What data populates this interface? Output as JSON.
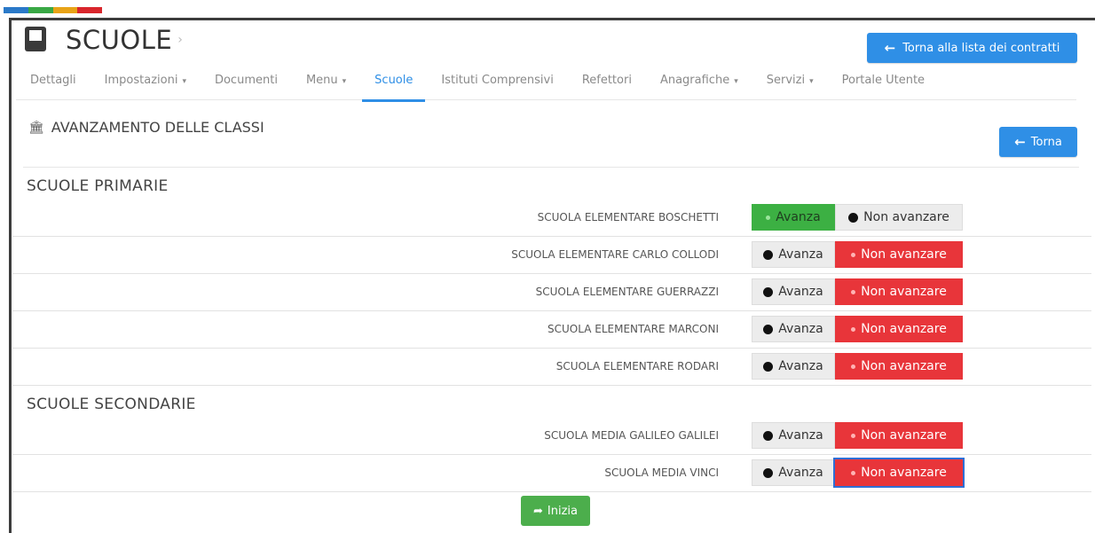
{
  "colorbar": [
    "#2a79c8",
    "#39a845",
    "#e8a317",
    "#d9262c"
  ],
  "header": {
    "title": "SCUOLE",
    "icon": "book-icon"
  },
  "back_to_contracts": {
    "label": "Torna alla lista dei contratti",
    "icon": "arrow-left-icon"
  },
  "tabs": [
    {
      "label": "Dettagli",
      "caret": ""
    },
    {
      "label": "Impostazioni",
      "caret": "▾"
    },
    {
      "label": "Documenti",
      "caret": ""
    },
    {
      "label": "Menu",
      "caret": "▾"
    },
    {
      "label": "Scuole",
      "caret": "",
      "active": true
    },
    {
      "label": "Istituti Comprensivi",
      "caret": ""
    },
    {
      "label": "Refettori",
      "caret": ""
    },
    {
      "label": "Anagrafiche",
      "caret": "▾"
    },
    {
      "label": "Servizi",
      "caret": "▾"
    },
    {
      "label": "Portale Utente",
      "caret": ""
    }
  ],
  "section": {
    "title": "AVANZAMENTO DELLE CLASSI",
    "icon": "bank-icon",
    "back_label": "Torna"
  },
  "groups": {
    "primarie": {
      "title": "SCUOLE PRIMARIE",
      "schools": [
        {
          "name": "SCUOLA ELEMENTARE BOSCHETTI",
          "state": "avanza"
        },
        {
          "name": "SCUOLA ELEMENTARE CARLO COLLODI",
          "state": "non"
        },
        {
          "name": "SCUOLA ELEMENTARE GUERRAZZI",
          "state": "non"
        },
        {
          "name": "SCUOLA ELEMENTARE MARCONI",
          "state": "non"
        },
        {
          "name": "SCUOLA ELEMENTARE RODARI",
          "state": "non"
        }
      ]
    },
    "secondarie": {
      "title": "SCUOLE SECONDARIE",
      "schools": [
        {
          "name": "SCUOLA MEDIA GALILEO GALILEI",
          "state": "non"
        },
        {
          "name": "SCUOLA MEDIA VINCI",
          "state": "non"
        }
      ]
    }
  },
  "toggle_labels": {
    "avanza": "Avanza",
    "non": "Non avanzare"
  },
  "start_button": {
    "label": "Inizia",
    "icon": "share-icon"
  }
}
